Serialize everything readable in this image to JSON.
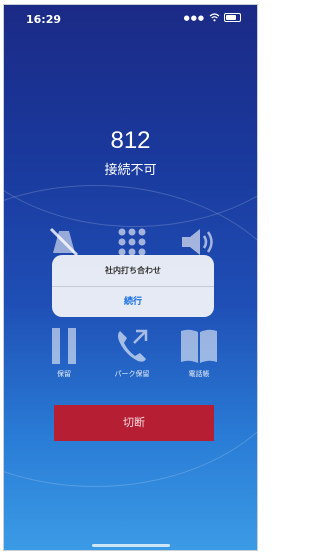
{
  "status_bar": {
    "time": "16:29",
    "signal_icon": "signal-dots-icon",
    "wifi_icon": "wifi-icon",
    "battery_icon": "battery-icon"
  },
  "call": {
    "number": "812",
    "status": "接続不可"
  },
  "controls": {
    "top_row": [
      {
        "icon": "mute-icon"
      },
      {
        "icon": "keypad-icon"
      },
      {
        "icon": "speaker-icon"
      }
    ],
    "bottom_row": [
      {
        "icon": "hold-icon",
        "label": "保留"
      },
      {
        "icon": "park-hold-icon",
        "label": "パーク保留"
      },
      {
        "icon": "phonebook-icon",
        "label": "電話帳"
      }
    ]
  },
  "dialog": {
    "title": "社内打ち合わせ",
    "button": "続行"
  },
  "hangup": {
    "label": "切断",
    "color": "#b51e33"
  },
  "colors": {
    "bg_top": "#1b2a86",
    "bg_bottom": "#3b9be6",
    "accent": "#1a6fe0"
  }
}
